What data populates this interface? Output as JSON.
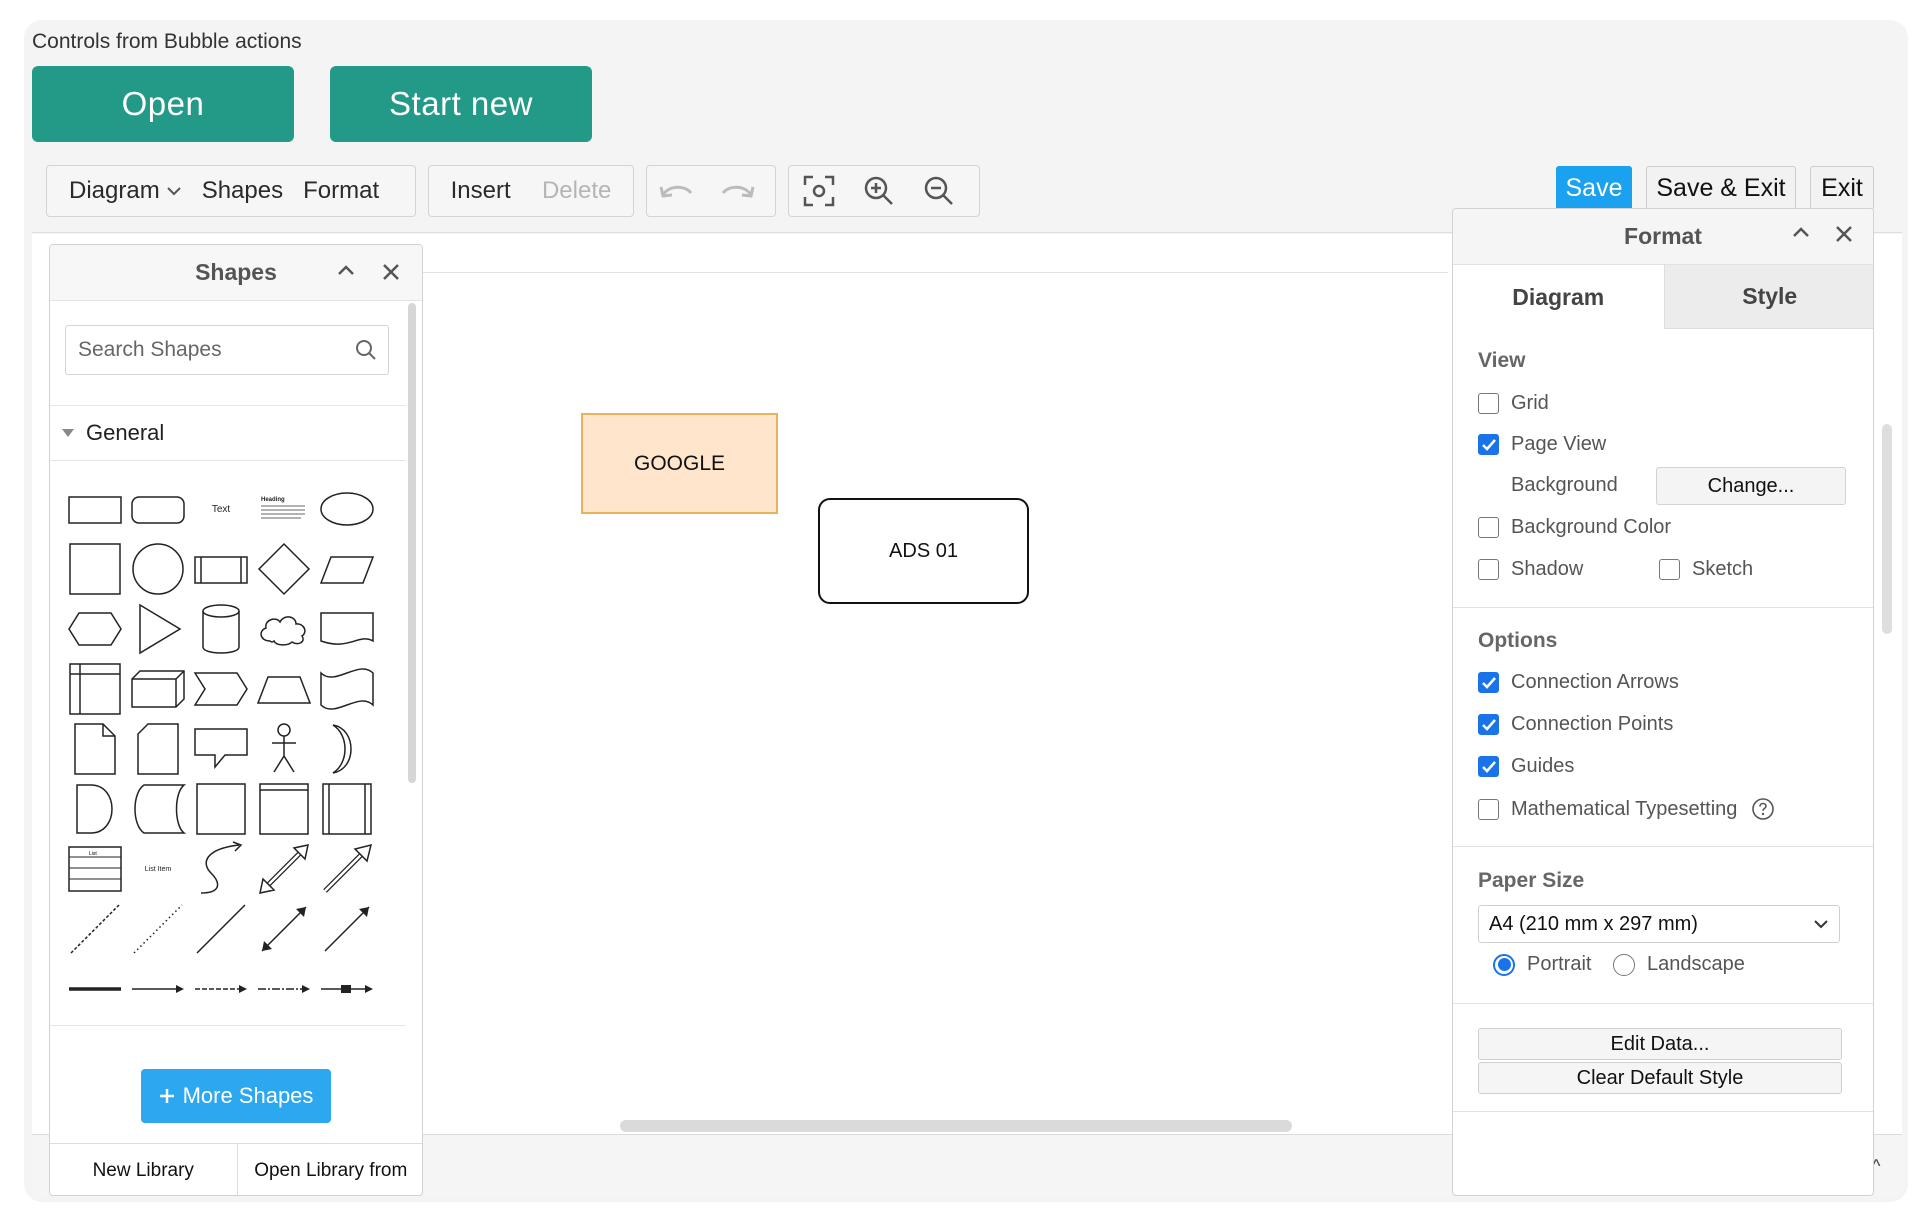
{
  "app": {
    "caption": "Controls from Bubble actions",
    "open_label": "Open",
    "start_new_label": "Start new"
  },
  "toolbar": {
    "diagram_label": "Diagram",
    "shapes_label": "Shapes",
    "format_label": "Format",
    "insert_label": "Insert",
    "delete_label": "Delete",
    "icons": [
      "undo-icon",
      "redo-icon",
      "fit-icon",
      "zoom-in-icon",
      "zoom-out-icon"
    ],
    "save_label": "Save",
    "save_exit_label": "Save & Exit",
    "exit_label": "Exit",
    "save_color": "#1aa1f0"
  },
  "shapes_panel": {
    "title": "Shapes",
    "search_placeholder": "Search Shapes",
    "general_label": "General",
    "text_shape_label": "Text",
    "heading_shape_label": "Heading",
    "list_item_label": "List Item",
    "list_label": "List",
    "more_shapes_label": "More Shapes",
    "new_library_label": "New Library",
    "open_library_label": "Open Library from"
  },
  "diagram": {
    "shapes": [
      {
        "label": "GOOGLE",
        "fill": "#ffe5cc",
        "stroke": "#e8b15c"
      },
      {
        "label": "ADS 01",
        "fill": "#ffffff",
        "stroke": "#111111"
      }
    ]
  },
  "format_panel": {
    "title": "Format",
    "tabs": [
      "Diagram",
      "Style"
    ],
    "view": {
      "title": "View",
      "grid": {
        "label": "Grid",
        "checked": false
      },
      "page_view": {
        "label": "Page View",
        "checked": true
      },
      "background_label": "Background",
      "change_label": "Change...",
      "background_color": {
        "label": "Background Color",
        "checked": false
      },
      "shadow": {
        "label": "Shadow",
        "checked": false
      },
      "sketch": {
        "label": "Sketch",
        "checked": false
      }
    },
    "options": {
      "title": "Options",
      "connection_arrows": {
        "label": "Connection Arrows",
        "checked": true
      },
      "connection_points": {
        "label": "Connection Points",
        "checked": true
      },
      "guides": {
        "label": "Guides",
        "checked": true
      },
      "math": {
        "label": "Mathematical Typesetting",
        "checked": false
      }
    },
    "paper": {
      "title": "Paper Size",
      "selected": "A4 (210 mm x 297 mm)",
      "portrait_label": "Portrait",
      "landscape_label": "Landscape",
      "orientation": "portrait"
    },
    "edit_data_label": "Edit Data...",
    "clear_style_label": "Clear Default Style"
  }
}
